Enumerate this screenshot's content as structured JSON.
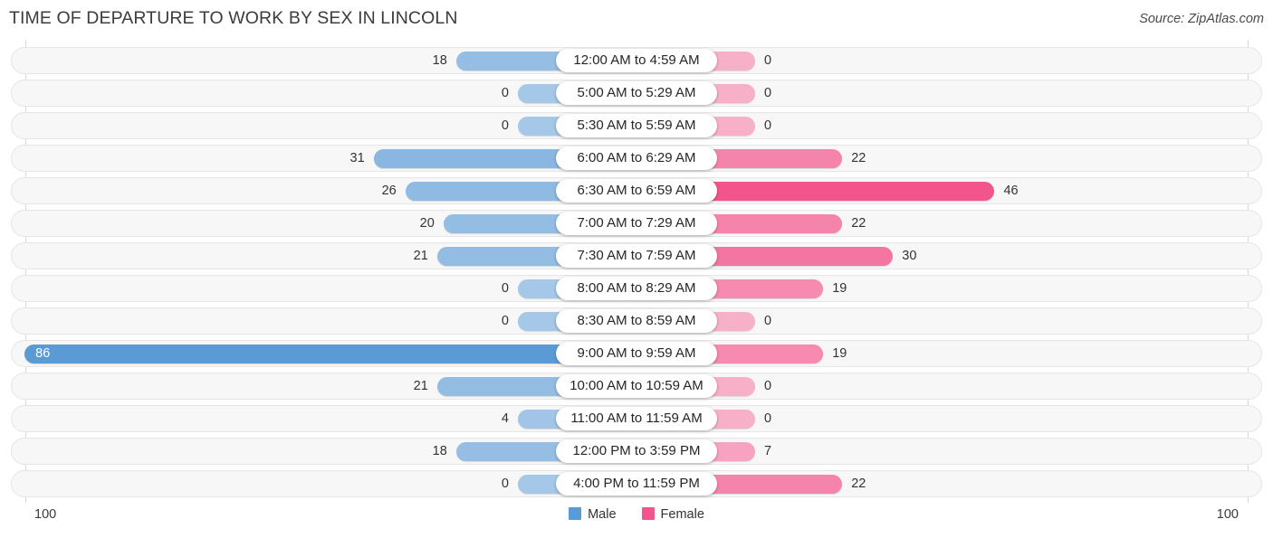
{
  "header": {
    "title": "TIME OF DEPARTURE TO WORK BY SEX IN LINCOLN",
    "source": "Source: ZipAtlas.com"
  },
  "axis": {
    "left_max": "100",
    "right_max": "100"
  },
  "legend": {
    "items": [
      {
        "label": "Male",
        "color": "#5B9BD5"
      },
      {
        "label": "Female",
        "color": "#F2558C"
      }
    ]
  },
  "chart_data": {
    "type": "bar",
    "title": "TIME OF DEPARTURE TO WORK BY SEX IN LINCOLN",
    "subtitle": "Source: ZipAtlas.com",
    "orientation": "horizontal-diverging",
    "xlabel": "",
    "ylabel": "",
    "xlim": [
      100,
      100
    ],
    "grid": false,
    "legend_position": "bottom-center",
    "categories": [
      "12:00 AM to 4:59 AM",
      "5:00 AM to 5:29 AM",
      "5:30 AM to 5:59 AM",
      "6:00 AM to 6:29 AM",
      "6:30 AM to 6:59 AM",
      "7:00 AM to 7:29 AM",
      "7:30 AM to 7:59 AM",
      "8:00 AM to 8:29 AM",
      "8:30 AM to 8:59 AM",
      "9:00 AM to 9:59 AM",
      "10:00 AM to 10:59 AM",
      "11:00 AM to 11:59 AM",
      "12:00 PM to 3:59 PM",
      "4:00 PM to 11:59 PM"
    ],
    "series": [
      {
        "name": "Male",
        "side": "left",
        "color": "#5B9BD5",
        "values": [
          18,
          0,
          0,
          31,
          26,
          20,
          21,
          0,
          0,
          86,
          21,
          4,
          18,
          0
        ]
      },
      {
        "name": "Female",
        "side": "right",
        "color": "#F2558C",
        "values": [
          0,
          0,
          0,
          22,
          46,
          22,
          30,
          19,
          0,
          19,
          0,
          0,
          7,
          22
        ]
      }
    ]
  }
}
